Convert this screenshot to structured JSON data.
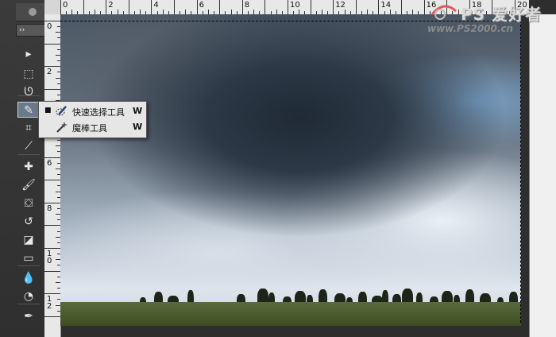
{
  "toolbar": {
    "collapse_label": "››",
    "tools": [
      {
        "name": "move-tool",
        "glyph": "▸"
      },
      {
        "name": "marquee-tool",
        "glyph": "⬚"
      },
      {
        "name": "lasso-tool",
        "glyph": "ᘎ"
      },
      {
        "name": "quick-selection-tool",
        "glyph": "✎"
      },
      {
        "name": "crop-tool",
        "glyph": "⌗"
      },
      {
        "name": "eyedropper-tool",
        "glyph": "⟋"
      },
      {
        "name": "healing-brush-tool",
        "glyph": "✚"
      },
      {
        "name": "brush-tool",
        "glyph": "🖌"
      },
      {
        "name": "clone-stamp-tool",
        "glyph": "⛋"
      },
      {
        "name": "history-brush-tool",
        "glyph": "↺"
      },
      {
        "name": "eraser-tool",
        "glyph": "◪"
      },
      {
        "name": "gradient-tool",
        "glyph": "▭"
      },
      {
        "name": "blur-tool",
        "glyph": "💧"
      },
      {
        "name": "dodge-tool",
        "glyph": "◔"
      },
      {
        "name": "pen-tool",
        "glyph": "✒"
      }
    ]
  },
  "ruler_top": {
    "labels": [
      "0",
      "2",
      "4",
      "6",
      "8",
      "10",
      "12",
      "14",
      "16",
      "18",
      "20"
    ]
  },
  "ruler_left": {
    "labels": [
      "0",
      "2",
      "4",
      "6",
      "8",
      "10",
      "12"
    ]
  },
  "flyout": {
    "items": [
      {
        "label": "快速选择工具",
        "shortcut": "W",
        "selected": true,
        "bullet": "■"
      },
      {
        "label": "魔棒工具",
        "shortcut": "W",
        "selected": false,
        "bullet": ""
      }
    ]
  },
  "watermark": {
    "title": "PS 爱好者",
    "url": "www.PS2000.cn"
  },
  "colors": {
    "panel": "#2e2e2e",
    "ruler": "#e8e8e8",
    "active_tool": "#6a7a8a"
  }
}
